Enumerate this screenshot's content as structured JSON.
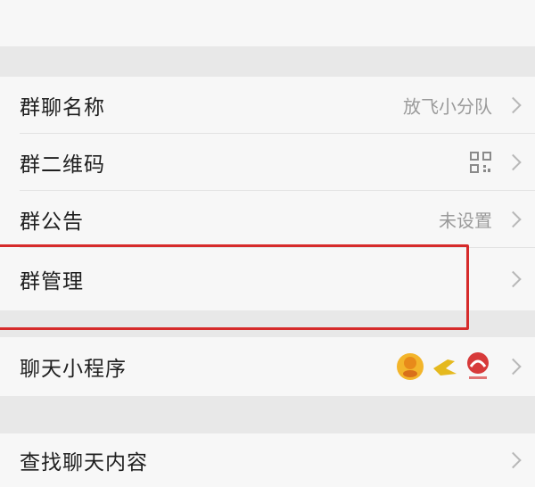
{
  "group_settings": {
    "items": [
      {
        "label": "群聊名称",
        "value": "放飞小分队"
      },
      {
        "label": "群二维码",
        "value": "",
        "icon": "qr-code-icon"
      },
      {
        "label": "群公告",
        "value": "未设置"
      },
      {
        "label": "群管理",
        "value": "",
        "highlighted": true
      },
      {
        "label": "聊天小程序",
        "value": "",
        "icons": [
          "mini-program-app-icon-1",
          "mini-program-app-icon-2",
          "mini-program-app-icon-3"
        ]
      },
      {
        "label": "查找聊天内容",
        "value": ""
      }
    ]
  },
  "colors": {
    "highlight": "#d62b2b",
    "background": "#ececec",
    "row_background": "#f7f7f7"
  }
}
